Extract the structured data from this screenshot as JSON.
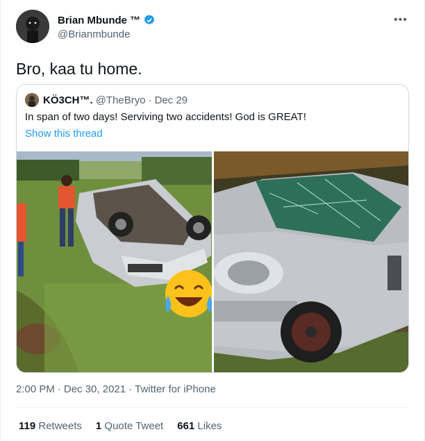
{
  "author": {
    "name": "Brian Mbunde ™",
    "handle": "@Brianmbunde",
    "verified": true
  },
  "tweet": {
    "text": "Bro, kaa tu home."
  },
  "quoted": {
    "name": "KÖ3CH™.",
    "handle": "@TheBryo",
    "separator": "·",
    "date": "Dec 29",
    "text": "In span of two days! Serviving two accidents! God is GREAT!",
    "link": "Show this thread",
    "media": [
      {
        "description_icon": "overturned-car-photo"
      },
      {
        "description_icon": "damaged-car-photo"
      }
    ]
  },
  "meta": {
    "time": "2:00 PM",
    "separator": "·",
    "date": "Dec 30, 2021",
    "source": "Twitter for iPhone"
  },
  "stats": [
    {
      "count": "119",
      "label": "Retweets"
    },
    {
      "count": "1",
      "label": "Quote Tweet"
    },
    {
      "count": "661",
      "label": "Likes"
    }
  ],
  "colors": {
    "accent": "#1d9bf0",
    "text": "#0f1419",
    "secondary": "#536471",
    "border": "#cfd9de"
  }
}
